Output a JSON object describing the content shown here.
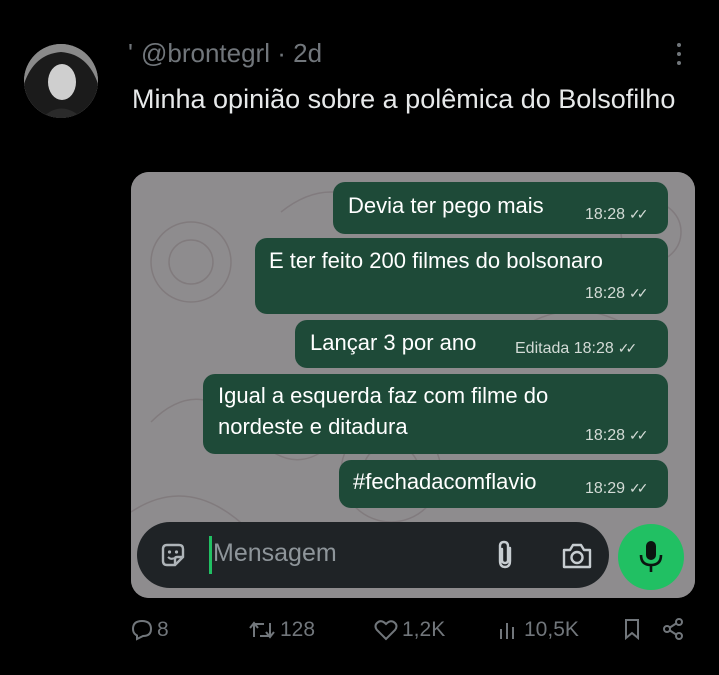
{
  "tweet": {
    "prefix_mark": "'",
    "handle": "@brontegrl",
    "separator": "·",
    "time": "2d",
    "text": "Minha opinião sobre a polêmica do Bolsofilho"
  },
  "chat": {
    "messages": [
      {
        "text": "Devia ter pego mais",
        "meta": "18:28"
      },
      {
        "text": "E ter feito 200 filmes do bolsonaro",
        "meta": "18:28"
      },
      {
        "text": "Lançar 3 por ano",
        "meta": "Editada 18:28"
      },
      {
        "text": "Igual a esquerda faz com filme do\nnordeste e ditadura",
        "meta": "18:28"
      },
      {
        "text": "#fechadacomflavio",
        "meta": "18:29"
      }
    ],
    "composer_placeholder": "Mensagem"
  },
  "actions": {
    "replies": "8",
    "retweets": "128",
    "likes": "1,2K",
    "views": "10,5K"
  },
  "colors": {
    "bubble": "#1e4a38",
    "accent_green": "#21c063",
    "muted": "#71767b"
  }
}
